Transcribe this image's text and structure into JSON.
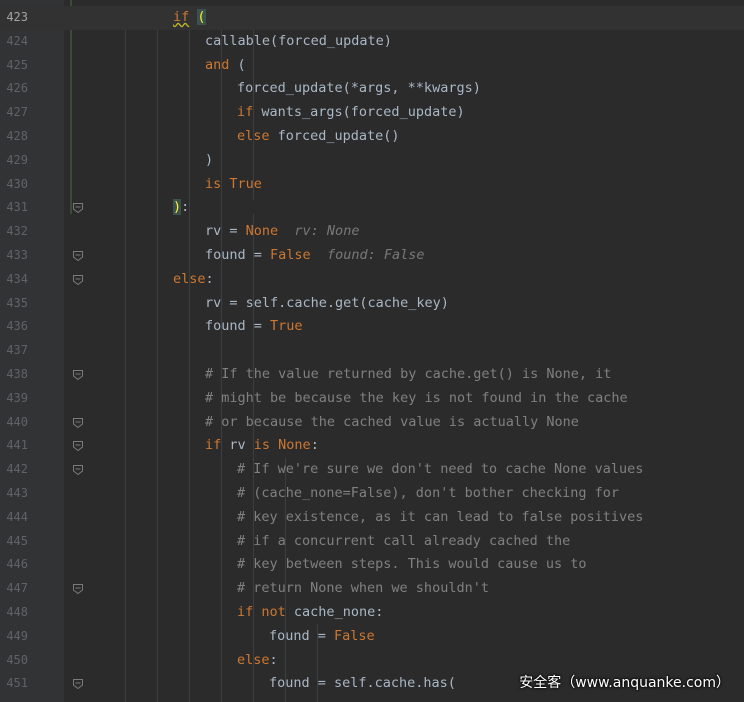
{
  "editor": {
    "language": "python",
    "first_line": 423,
    "lines": [
      {
        "num": "423",
        "indent": 11,
        "tokens": [
          {
            "t": "if",
            "c": "kw squiggle"
          },
          {
            "t": " ",
            "c": ""
          },
          {
            "t": "(",
            "c": "match"
          }
        ]
      },
      {
        "num": "424",
        "indent": 15,
        "tokens": [
          {
            "t": "callable(forced_update)",
            "c": ""
          }
        ]
      },
      {
        "num": "425",
        "indent": 15,
        "tokens": [
          {
            "t": "and",
            "c": "kw"
          },
          {
            "t": " (",
            "c": ""
          }
        ]
      },
      {
        "num": "426",
        "indent": 19,
        "tokens": [
          {
            "t": "forced_update(*args, **kwargs)",
            "c": ""
          }
        ]
      },
      {
        "num": "427",
        "indent": 19,
        "tokens": [
          {
            "t": "if",
            "c": "kw"
          },
          {
            "t": " wants_args(forced_update)",
            "c": ""
          }
        ]
      },
      {
        "num": "428",
        "indent": 19,
        "tokens": [
          {
            "t": "else",
            "c": "kw"
          },
          {
            "t": " forced_update()",
            "c": ""
          }
        ]
      },
      {
        "num": "429",
        "indent": 15,
        "tokens": [
          {
            "t": ")",
            "c": ""
          }
        ]
      },
      {
        "num": "430",
        "indent": 15,
        "tokens": [
          {
            "t": "is",
            "c": "kw"
          },
          {
            "t": " ",
            "c": ""
          },
          {
            "t": "True",
            "c": "kw"
          }
        ]
      },
      {
        "num": "431",
        "indent": 11,
        "tokens": [
          {
            "t": ")",
            "c": "match"
          },
          {
            "t": ":",
            "c": ""
          }
        ]
      },
      {
        "num": "432",
        "indent": 15,
        "tokens": [
          {
            "t": "rv = ",
            "c": ""
          },
          {
            "t": "None",
            "c": "kw"
          },
          {
            "t": "  ",
            "c": ""
          },
          {
            "t": "rv: None",
            "c": "hint"
          }
        ]
      },
      {
        "num": "433",
        "indent": 15,
        "tokens": [
          {
            "t": "found = ",
            "c": ""
          },
          {
            "t": "False",
            "c": "kw"
          },
          {
            "t": "  ",
            "c": ""
          },
          {
            "t": "found: False",
            "c": "hint"
          }
        ]
      },
      {
        "num": "434",
        "indent": 11,
        "tokens": [
          {
            "t": "else",
            "c": "kw"
          },
          {
            "t": ":",
            "c": ""
          }
        ]
      },
      {
        "num": "435",
        "indent": 15,
        "tokens": [
          {
            "t": "rv = self.cache.get(cache_key)",
            "c": ""
          }
        ]
      },
      {
        "num": "436",
        "indent": 15,
        "tokens": [
          {
            "t": "found = ",
            "c": ""
          },
          {
            "t": "True",
            "c": "kw"
          }
        ]
      },
      {
        "num": "437",
        "indent": 15,
        "tokens": []
      },
      {
        "num": "438",
        "indent": 15,
        "tokens": [
          {
            "t": "# If the value returned by cache.get() is None, it",
            "c": "cm"
          }
        ]
      },
      {
        "num": "439",
        "indent": 15,
        "tokens": [
          {
            "t": "# might be because the key is not found in the cache",
            "c": "cm"
          }
        ]
      },
      {
        "num": "440",
        "indent": 15,
        "tokens": [
          {
            "t": "# or because the cached value is actually None",
            "c": "cm"
          }
        ]
      },
      {
        "num": "441",
        "indent": 15,
        "tokens": [
          {
            "t": "if",
            "c": "kw"
          },
          {
            "t": " rv ",
            "c": ""
          },
          {
            "t": "is None",
            "c": "kw"
          },
          {
            "t": ":",
            "c": ""
          }
        ]
      },
      {
        "num": "442",
        "indent": 19,
        "tokens": [
          {
            "t": "# If we're sure we don't need to cache None values",
            "c": "cm"
          }
        ]
      },
      {
        "num": "443",
        "indent": 19,
        "tokens": [
          {
            "t": "# (cache_none=False), don't bother checking for",
            "c": "cm"
          }
        ]
      },
      {
        "num": "444",
        "indent": 19,
        "tokens": [
          {
            "t": "# key existence, as it can lead to false positives",
            "c": "cm"
          }
        ]
      },
      {
        "num": "445",
        "indent": 19,
        "tokens": [
          {
            "t": "# if a concurrent call already cached the",
            "c": "cm"
          }
        ]
      },
      {
        "num": "446",
        "indent": 19,
        "tokens": [
          {
            "t": "# key between steps. This would cause us to",
            "c": "cm"
          }
        ]
      },
      {
        "num": "447",
        "indent": 19,
        "tokens": [
          {
            "t": "# return None when we shouldn't",
            "c": "cm"
          }
        ]
      },
      {
        "num": "448",
        "indent": 19,
        "tokens": [
          {
            "t": "if",
            "c": "kw"
          },
          {
            "t": " ",
            "c": ""
          },
          {
            "t": "not",
            "c": "kw"
          },
          {
            "t": " cache_none:",
            "c": ""
          }
        ]
      },
      {
        "num": "449",
        "indent": 23,
        "tokens": [
          {
            "t": "found = ",
            "c": ""
          },
          {
            "t": "False",
            "c": "kw"
          }
        ]
      },
      {
        "num": "450",
        "indent": 19,
        "tokens": [
          {
            "t": "else",
            "c": "kw"
          },
          {
            "t": ":",
            "c": ""
          }
        ]
      },
      {
        "num": "451",
        "indent": 23,
        "tokens": [
          {
            "t": "found = self.cache.has(",
            "c": ""
          }
        ]
      }
    ],
    "fold_markers": [
      "431",
      "433",
      "434",
      "438",
      "440",
      "441",
      "442",
      "447",
      "451"
    ],
    "current_line": "423"
  },
  "watermark": "安全客（www.anquanke.com）",
  "colors": {
    "background": "#2b2b2b",
    "gutter": "#313335",
    "keyword": "#cc7832",
    "comment": "#808080",
    "text": "#a9b7c6",
    "brace_match": "#ffef28"
  }
}
